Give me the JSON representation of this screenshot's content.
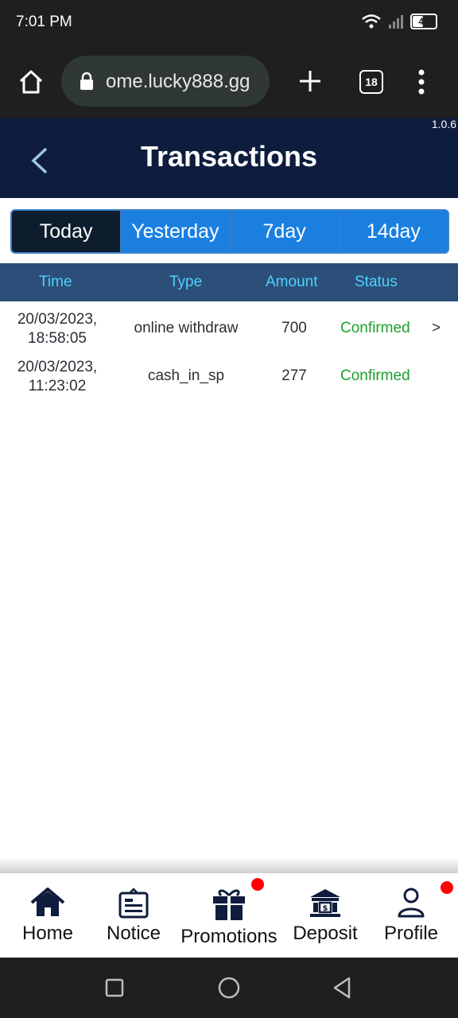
{
  "status_bar": {
    "time": "7:01 PM",
    "battery": "43"
  },
  "browser": {
    "url": "ome.lucky888.gg",
    "tab_count": "18"
  },
  "app": {
    "version": "1.0.6",
    "title": "Transactions"
  },
  "tabs": [
    {
      "label": "Today",
      "active": true
    },
    {
      "label": "Yesterday",
      "active": false
    },
    {
      "label": "7day",
      "active": false
    },
    {
      "label": "14day",
      "active": false
    }
  ],
  "table": {
    "headers": {
      "time": "Time",
      "type": "Type",
      "amount": "Amount",
      "status": "Status"
    },
    "rows": [
      {
        "date": "20/03/2023,",
        "clock": "18:58:05",
        "type": "online withdraw",
        "amount": "700",
        "status": "Confirmed",
        "chevron": ">"
      },
      {
        "date": "20/03/2023,",
        "clock": "11:23:02",
        "type": "cash_in_sp",
        "amount": "277",
        "status": "Confirmed",
        "chevron": ""
      }
    ]
  },
  "bottom_nav": [
    {
      "label": "Home",
      "icon": "home-icon"
    },
    {
      "label": "Notice",
      "icon": "notice-icon"
    },
    {
      "label": "Promotions",
      "icon": "gift-icon",
      "badge": true
    },
    {
      "label": "Deposit",
      "icon": "bank-icon"
    },
    {
      "label": "Profile",
      "icon": "user-icon",
      "badge": true
    }
  ],
  "colors": {
    "header_bg": "#0e1d3d",
    "tab_blue": "#1b7fe0",
    "thead_bg": "#2b4f78",
    "status_green": "#1aa32b",
    "badge_red": "#ff0000"
  }
}
